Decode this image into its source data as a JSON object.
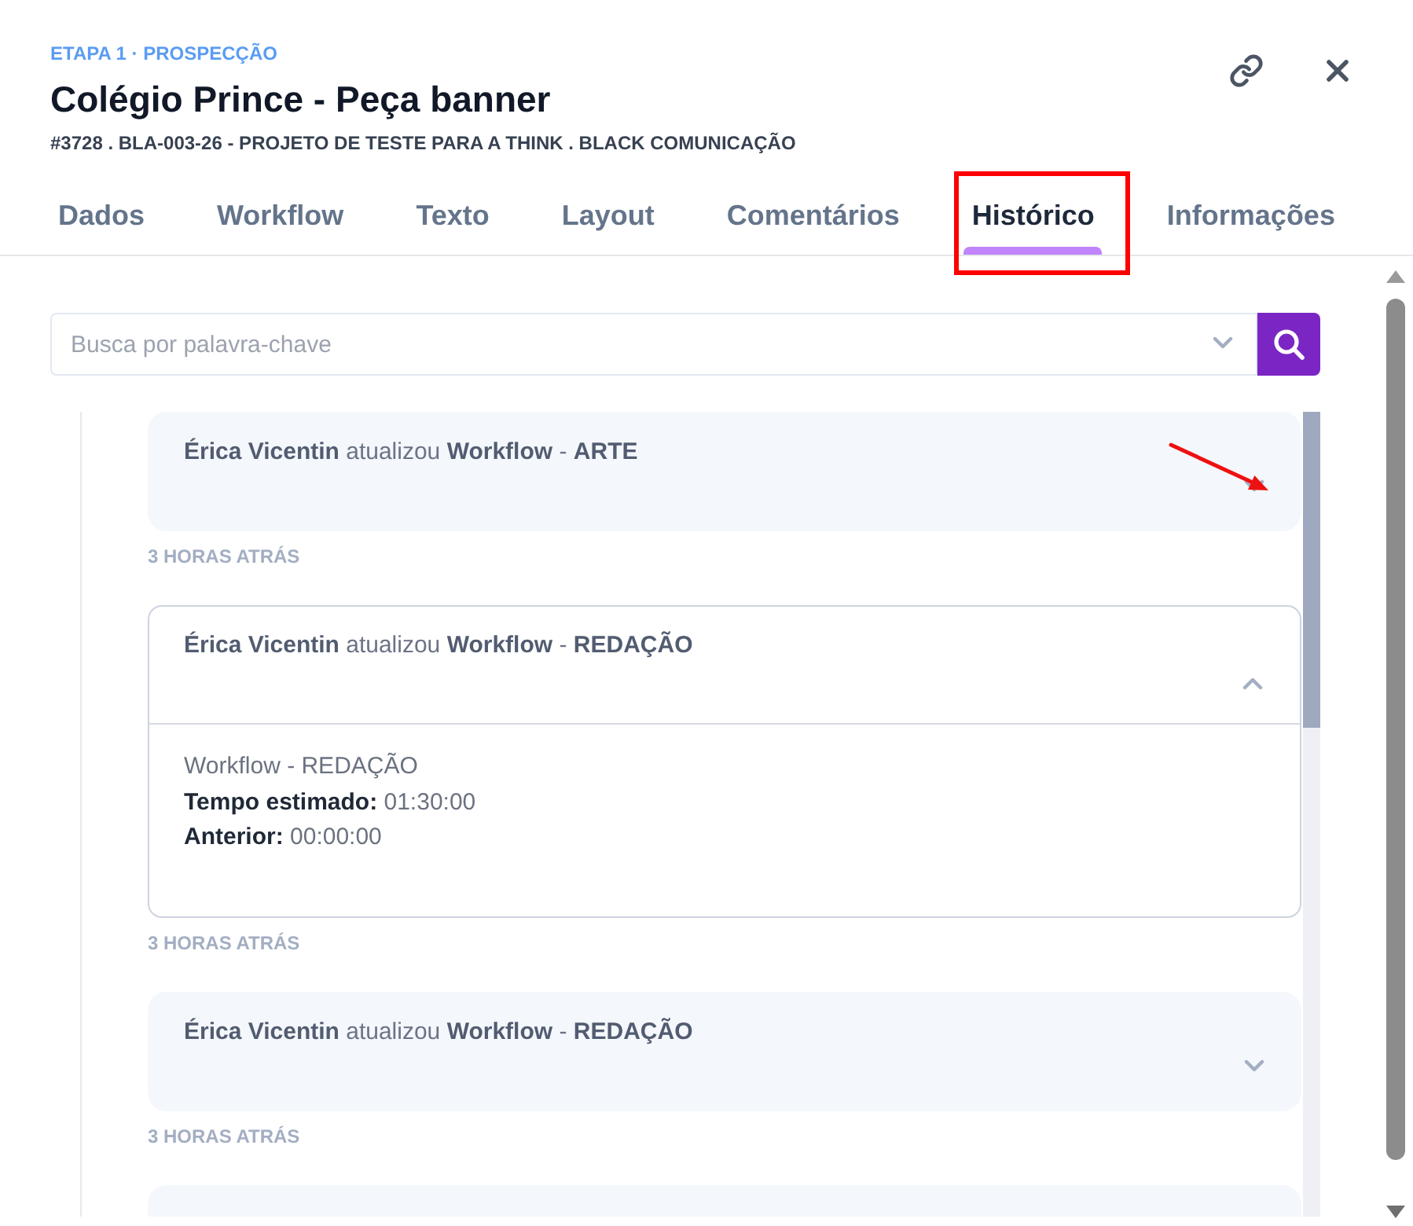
{
  "header": {
    "stage": "ETAPA 1 · PROSPECÇÃO",
    "title": "Colégio Prince - Peça banner",
    "subtitle": "#3728 . BLA-003-26 - PROJETO DE TESTE PARA A THINK . BLACK COMUNICAÇÃO"
  },
  "tabs": [
    {
      "label": "Dados",
      "selected": false
    },
    {
      "label": "Workflow",
      "selected": false
    },
    {
      "label": "Texto",
      "selected": false
    },
    {
      "label": "Layout",
      "selected": false
    },
    {
      "label": "Comentários",
      "selected": false
    },
    {
      "label": "Histórico",
      "selected": true
    },
    {
      "label": "Informações",
      "selected": false
    }
  ],
  "search": {
    "placeholder": "Busca por palavra-chave"
  },
  "history": [
    {
      "title": "**Érica Vicentin** atualizou **Workflow** - **ARTE**",
      "expanded": false,
      "time": "3 HORAS ATRÁS"
    },
    {
      "title": "**Érica Vicentin** atualizou **Workflow** - **REDAÇÃO**",
      "expanded": true,
      "details": [
        "Workflow - REDAÇÃO",
        "**Tempo estimado:** 01:30:00",
        "**Anterior:** 00:00:00"
      ],
      "time": "3 HORAS ATRÁS"
    },
    {
      "title": "**Érica Vicentin** atualizou **Workflow** - **REDAÇÃO**",
      "expanded": false,
      "time": "3 HORAS ATRÁS"
    },
    {
      "expanded": false
    }
  ]
}
